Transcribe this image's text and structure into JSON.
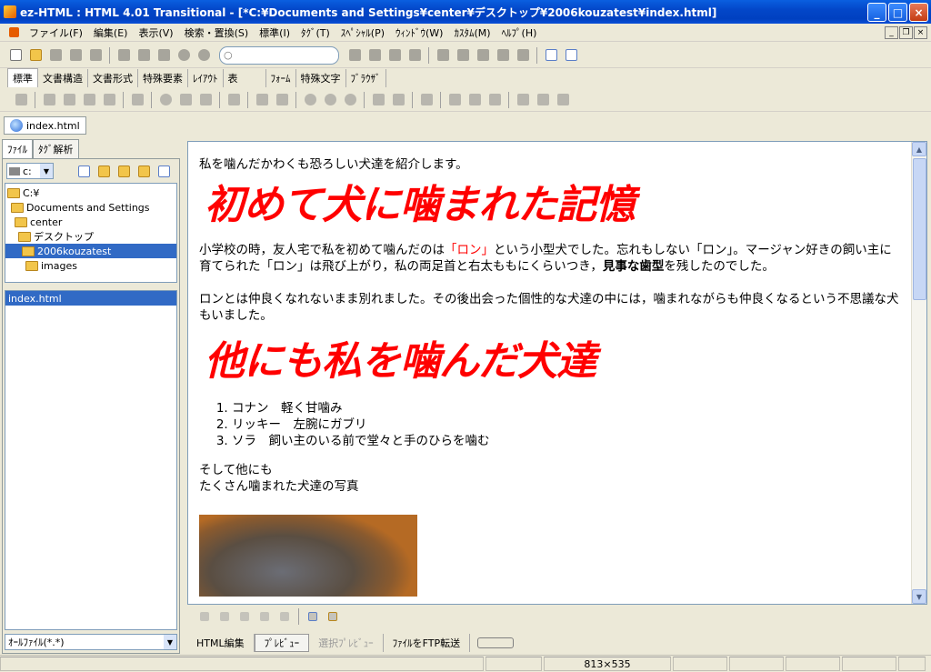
{
  "window": {
    "title": "ez-HTML : HTML 4.01 Transitional - [*C:¥Documents and Settings¥center¥デスクトップ¥2006kouzatest¥index.html]",
    "buttons": {
      "minimize": "_",
      "maximize": "□",
      "close": "×"
    }
  },
  "menubar": {
    "items": [
      "ファイル(F)",
      "編集(E)",
      "表示(V)",
      "検索・置換(S)",
      "標準(I)",
      "ﾀｸﾞ(T)",
      "ｽﾍﾟｼｬﾙ(P)",
      "ｳｨﾝﾄﾞｳ(W)",
      "ｶｽﾀﾑ(M)",
      "ﾍﾙﾌﾟ(H)"
    ],
    "mdi": {
      "minimize": "_",
      "restore": "❐",
      "close": "×"
    }
  },
  "toolbar": {
    "search_placeholder": ""
  },
  "palette_tabs": [
    "標準",
    "文書構造",
    "文書形式",
    "特殊要素",
    "ﾚｲｱｳﾄ",
    "表",
    "ﾌｫｰﾑ",
    "特殊文字",
    "ﾌﾞﾗｳｻﾞ"
  ],
  "document_tab": {
    "label": "index.html"
  },
  "left_tabs": [
    "ﾌｧｲﾙ",
    "ﾀｸﾞ解析"
  ],
  "drive": {
    "value": "c:"
  },
  "folder_tree": [
    {
      "label": "C:¥",
      "depth": 0,
      "selected": false
    },
    {
      "label": "Documents and Settings",
      "depth": 1,
      "selected": false
    },
    {
      "label": "center",
      "depth": 2,
      "selected": false
    },
    {
      "label": "デスクトップ",
      "depth": 3,
      "selected": false
    },
    {
      "label": "2006kouzatest",
      "depth": 4,
      "selected": true
    },
    {
      "label": "images",
      "depth": 5,
      "selected": false
    }
  ],
  "file_list": [
    "index.html"
  ],
  "filter": {
    "value": "ｵｰﾙﾌｧｲﾙ(*.*)"
  },
  "preview": {
    "intro": "私を噛んだかわくも恐ろしい犬達を紹介します。",
    "heading1": "初めて犬に噛まれた記憶",
    "para1_a": "小学校の時，友人宅で私を初めて噛んだのは",
    "para1_red": "「ロン」",
    "para1_b": "という小型犬でした。忘れもしない「ロン」。マージャン好きの飼い主に育てられた「ロン」は飛び上がり，私の両足首と右太ももにくらいつき，",
    "para1_bold": "見事な歯型",
    "para1_c": "を残したのでした。",
    "para2": "ロンとは仲良くなれないまま別れました。その後出会った個性的な犬達の中には，噛まれながらも仲良くなるという不思議な犬もいました。",
    "heading2": "他にも私を噛んだ犬達",
    "list": [
      "コナン　軽く甘噛み",
      "リッキー　左腕にガブリ",
      "ソラ　飼い主のいる前で堂々と手のひらを噛む"
    ],
    "outro1": "そして他にも",
    "outro2": "たくさん噛まれた犬達の写真"
  },
  "mode_tabs": [
    "HTML編集",
    "ﾌﾟﾚﾋﾞｭｰ",
    "選択ﾌﾟﾚﾋﾞｭｰ",
    "ﾌｧｲﾙをFTP転送"
  ],
  "status": {
    "size": "813×535"
  }
}
